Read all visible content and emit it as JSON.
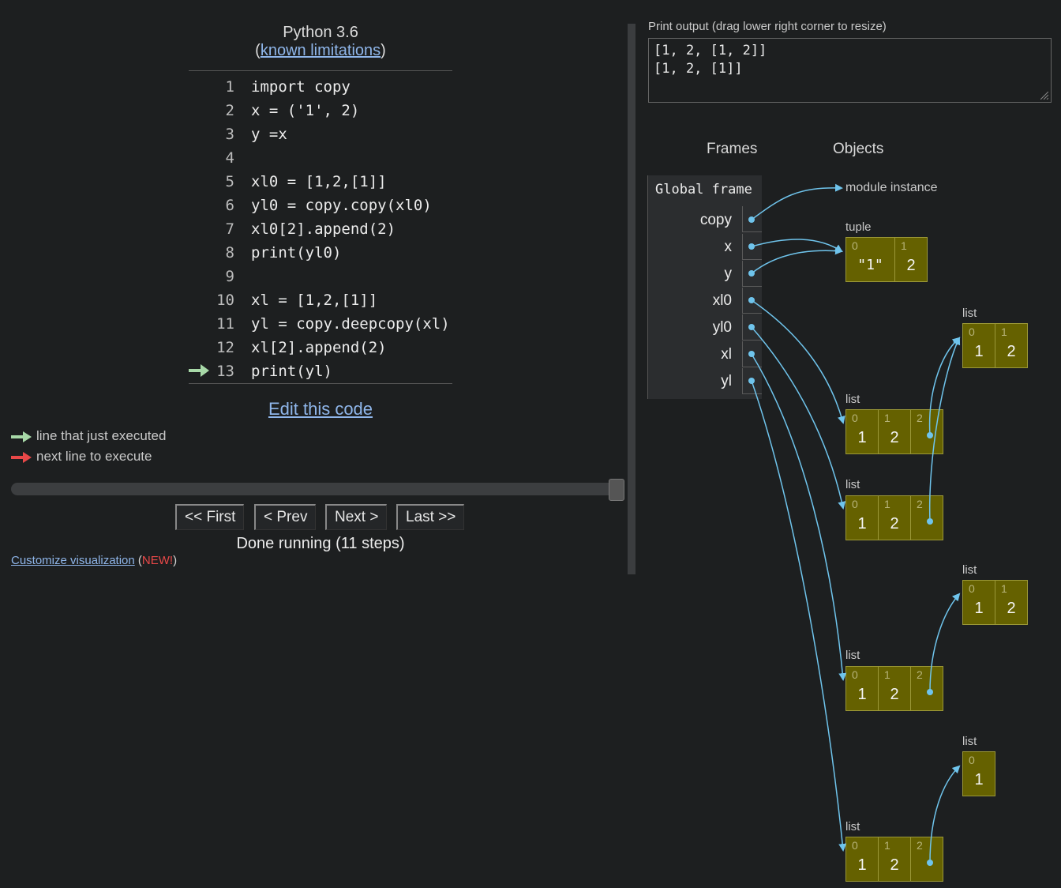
{
  "header": {
    "language": "Python 3.6",
    "limitations_open": "(",
    "limitations_link": "known limitations",
    "limitations_close": ")"
  },
  "code_lines": [
    {
      "num": "1",
      "text": "import copy"
    },
    {
      "num": "2",
      "text": "x = ('1', 2)"
    },
    {
      "num": "3",
      "text": "y =x"
    },
    {
      "num": "4",
      "text": ""
    },
    {
      "num": "5",
      "text": "xl0 = [1,2,[1]]"
    },
    {
      "num": "6",
      "text": "yl0 = copy.copy(xl0)"
    },
    {
      "num": "7",
      "text": "xl0[2].append(2)"
    },
    {
      "num": "8",
      "text": "print(yl0)"
    },
    {
      "num": "9",
      "text": ""
    },
    {
      "num": "10",
      "text": "xl = [1,2,[1]]"
    },
    {
      "num": "11",
      "text": "yl = copy.deepcopy(xl)"
    },
    {
      "num": "12",
      "text": "xl[2].append(2)"
    },
    {
      "num": "13",
      "text": "print(yl)"
    }
  ],
  "current_line": 13,
  "edit_link": "Edit this code",
  "legend": {
    "just_executed": "line that just executed",
    "next_line": "next line to execute",
    "just_executed_color": "#a8d9a8",
    "next_line_color": "#e84848"
  },
  "slider": {
    "position": 1.0
  },
  "nav": {
    "first": "<< First",
    "prev": "< Prev",
    "next": "Next >",
    "last": "Last >>"
  },
  "status": "Done running (11 steps)",
  "customize": {
    "link": "Customize visualization",
    "open": "(",
    "new": "NEW!",
    "close": ")"
  },
  "output": {
    "label": "Print output (drag lower right corner to resize)",
    "lines": [
      "[1, 2, [1, 2]]",
      "[1, 2, [1]]"
    ]
  },
  "frames_header": "Frames",
  "objects_header": "Objects",
  "global_frame": {
    "title": "Global frame",
    "vars": [
      "copy",
      "x",
      "y",
      "xl0",
      "yl0",
      "xl",
      "yl"
    ]
  },
  "objects": {
    "module": "module instance",
    "tuple_label": "tuple",
    "tuple_cells": [
      {
        "idx": "0",
        "val": "\"1\""
      },
      {
        "idx": "1",
        "val": "2"
      }
    ],
    "list_label": "list",
    "inner_a": [
      {
        "idx": "0",
        "val": "1"
      },
      {
        "idx": "1",
        "val": "2"
      }
    ],
    "xl0_list": [
      {
        "idx": "0",
        "val": "1"
      },
      {
        "idx": "1",
        "val": "2"
      },
      {
        "idx": "2",
        "val": ""
      }
    ],
    "yl0_list": [
      {
        "idx": "0",
        "val": "1"
      },
      {
        "idx": "1",
        "val": "2"
      },
      {
        "idx": "2",
        "val": ""
      }
    ],
    "inner_b": [
      {
        "idx": "0",
        "val": "1"
      },
      {
        "idx": "1",
        "val": "2"
      }
    ],
    "xl_list": [
      {
        "idx": "0",
        "val": "1"
      },
      {
        "idx": "1",
        "val": "2"
      },
      {
        "idx": "2",
        "val": ""
      }
    ],
    "inner_c": [
      {
        "idx": "0",
        "val": "1"
      }
    ],
    "yl_list": [
      {
        "idx": "0",
        "val": "1"
      },
      {
        "idx": "1",
        "val": "2"
      },
      {
        "idx": "2",
        "val": ""
      }
    ]
  },
  "colors": {
    "pointer": "#6fc4ec",
    "heap_cell": "#656100",
    "background": "#1d1f20"
  }
}
